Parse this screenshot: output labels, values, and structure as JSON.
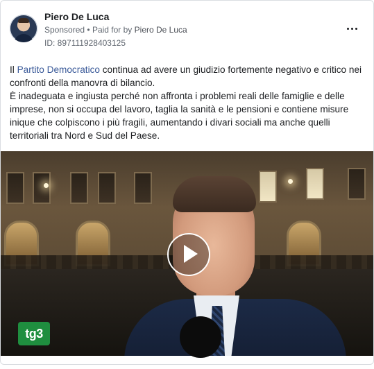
{
  "post": {
    "author_name": "Piero De Luca",
    "sponsored_label": "Sponsored",
    "separator": "•",
    "paid_for_prefix": "Paid for by",
    "paid_for_name": "Piero De Luca",
    "ad_id": "ID: 897111928403125",
    "more_icon": "more-horizontal-icon",
    "text": {
      "p1_prefix": "Il ",
      "p1_link": "Partito Democratico",
      "p1_rest": " continua ad avere un giudizio fortemente negativo e critico nei confronti della manovra di bilancio.",
      "p2": "È inadeguata e ingiusta perché non affronta i problemi reali delle famiglie e delle imprese, non si occupa del lavoro, taglia la sanità e le pensioni e contiene misure inique che colpiscono i più fragili, aumentando i divari sociali ma anche quelli territoriali tra Nord e Sud del Paese."
    },
    "video": {
      "watermark": "tg3",
      "play_icon": "play-icon"
    }
  },
  "colors": {
    "link": "#385898",
    "meta_text": "#606770",
    "tg3_green": "#1f8e3f"
  }
}
